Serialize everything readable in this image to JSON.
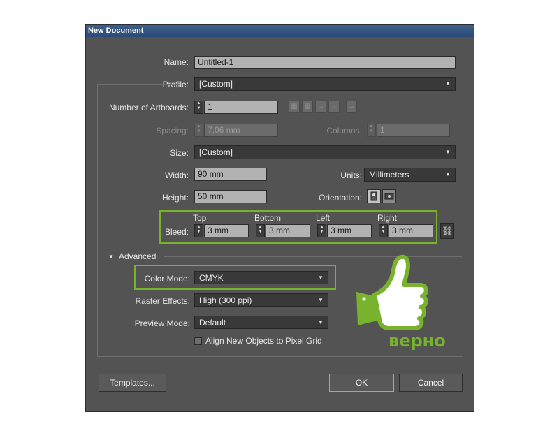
{
  "dialog": {
    "title": "New Document"
  },
  "name": {
    "label": "Name:",
    "value": "Untitled-1"
  },
  "profile": {
    "label": "Profile:",
    "value": "[Custom]"
  },
  "artboards": {
    "label": "Number of Artboards:",
    "value": "1"
  },
  "spacing": {
    "label": "Spacing:",
    "value": "7,06 mm"
  },
  "columns": {
    "label": "Columns:",
    "value": "1"
  },
  "size": {
    "label": "Size:",
    "value": "[Custom]"
  },
  "width": {
    "label": "Width:",
    "value": "90 mm"
  },
  "units": {
    "label": "Units:",
    "value": "Millimeters"
  },
  "height": {
    "label": "Height:",
    "value": "50 mm"
  },
  "orientation": {
    "label": "Orientation:"
  },
  "bleed": {
    "label": "Bleed:",
    "top": {
      "header": "Top",
      "value": "3 mm"
    },
    "bottom": {
      "header": "Bottom",
      "value": "3 mm"
    },
    "left": {
      "header": "Left",
      "value": "3 mm"
    },
    "right": {
      "header": "Right",
      "value": "3 mm"
    }
  },
  "advanced": {
    "label": "Advanced",
    "color_mode": {
      "label": "Color Mode:",
      "value": "CMYK"
    },
    "raster_effects": {
      "label": "Raster Effects:",
      "value": "High (300 ppi)"
    },
    "preview_mode": {
      "label": "Preview Mode:",
      "value": "Default"
    },
    "pixel_grid": {
      "label": "Align New Objects to Pixel Grid",
      "checked": false
    }
  },
  "buttons": {
    "templates": "Templates...",
    "ok": "OK",
    "cancel": "Cancel"
  },
  "overlay": {
    "caption": "верно",
    "color": "#79b22c"
  },
  "colors": {
    "accent_green": "#79b22c",
    "ok_border": "#e69a2c",
    "dialog_bg": "#535353",
    "title_bar": "#2a4a78"
  }
}
